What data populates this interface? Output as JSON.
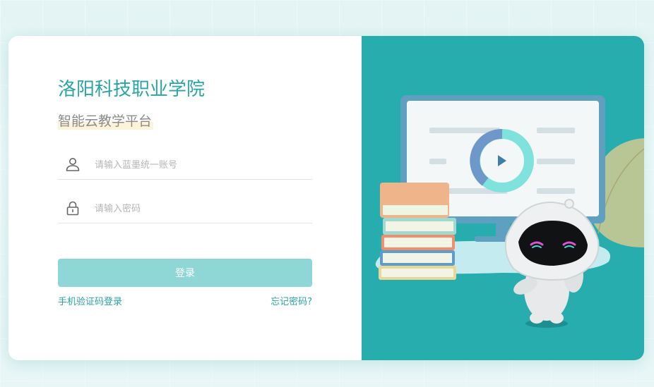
{
  "brand": {
    "school_name": "洛阳科技职业学院",
    "platform_name": "智能云教学平台"
  },
  "form": {
    "account_placeholder": "请输入蓝墨统一账号",
    "account_value": "",
    "account_icon": "user-icon",
    "password_placeholder": "请输入密码",
    "password_value": "",
    "password_icon": "lock-icon",
    "login_label": "登录",
    "sms_login_label": "手机验证码登录",
    "forgot_label": "忘记密码?"
  },
  "colors": {
    "accent": "#2aa4a4",
    "button": "#8fd6d6",
    "panel": "#27adae"
  },
  "illustration": {
    "name": "monitor-books-robot-illustration"
  }
}
